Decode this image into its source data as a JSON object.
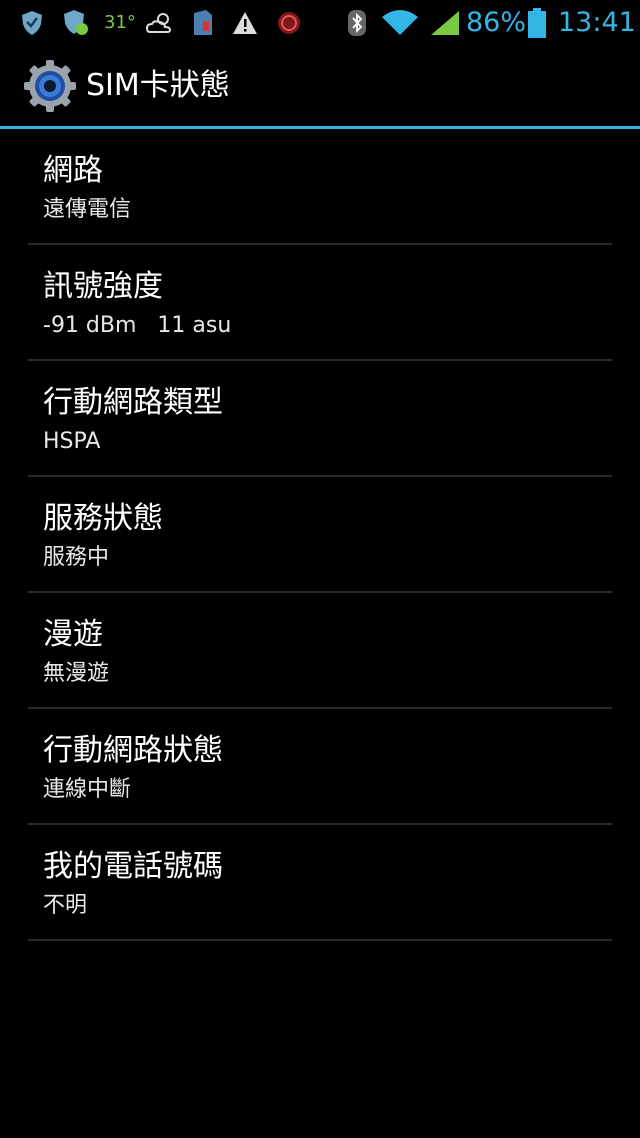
{
  "status_bar": {
    "temperature": "31°",
    "battery_percent": "86%",
    "time": "13:41",
    "icons": [
      "shield-icon",
      "shield-check-icon",
      "weather-cloud-sun-icon",
      "sim-card-icon",
      "warning-icon",
      "notification-badge-icon",
      "bluetooth-icon",
      "wifi-icon",
      "cell-signal-icon",
      "battery-icon"
    ],
    "accent_color": "#33b5e5"
  },
  "action_bar": {
    "title": "SIM卡狀態",
    "icon": "settings-gear-icon"
  },
  "items": [
    {
      "title": "網路",
      "summary": "遠傳電信"
    },
    {
      "title": "訊號強度",
      "summary": "-91 dBm   11 asu"
    },
    {
      "title": "行動網路類型",
      "summary": "HSPA"
    },
    {
      "title": "服務狀態",
      "summary": "服務中"
    },
    {
      "title": "漫遊",
      "summary": "無漫遊"
    },
    {
      "title": "行動網路狀態",
      "summary": "連線中斷"
    },
    {
      "title": "我的電話號碼",
      "summary": "不明"
    }
  ]
}
